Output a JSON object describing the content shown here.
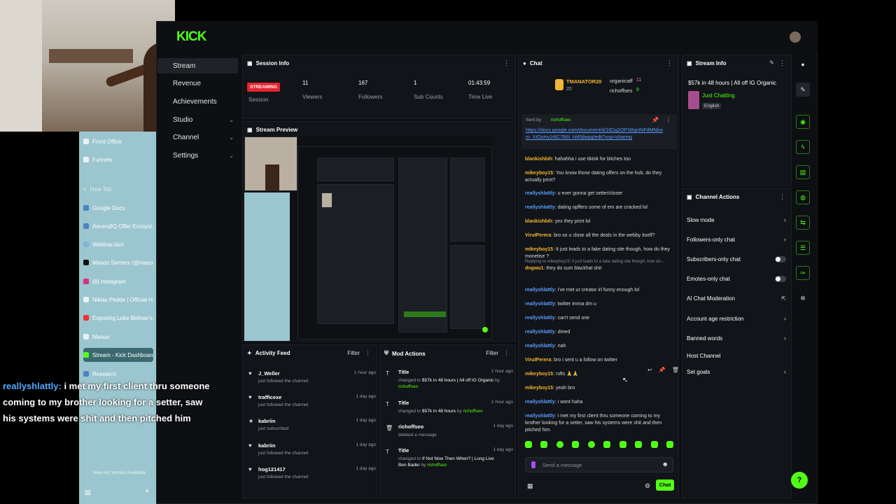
{
  "arc": {
    "items": [
      {
        "label": "Front Office"
      },
      {
        "label": "Funnels"
      },
      {
        "label": "New Tab"
      },
      {
        "label": "Google Docs"
      },
      {
        "label": "AscendIQ Offer Ecosyst..."
      },
      {
        "label": "WebinarJam"
      },
      {
        "label": "Mason Senters (@maso..."
      },
      {
        "label": "(8) Instagram"
      },
      {
        "label": "Niklas Pedde | Official H..."
      },
      {
        "label": "Exposing Luke Belmar's..."
      },
      {
        "label": "Manus"
      },
      {
        "label": "Stream - Kick Dashboard"
      },
      {
        "label": "Research"
      }
    ],
    "update_notice": "New Arc Version Available"
  },
  "caption": {
    "user": "reallyshlattly:",
    "text": " i met my first client thru someone coming to my brother looking for a setter, saw his systems were shit and then pitched him"
  },
  "logo": "KICK",
  "nav": {
    "items": [
      {
        "label": "Stream"
      },
      {
        "label": "Revenue"
      },
      {
        "label": "Achievements"
      },
      {
        "label": "Studio"
      },
      {
        "label": "Channel"
      },
      {
        "label": "Settings"
      }
    ]
  },
  "session": {
    "title": "Session Info",
    "status": "STREAMING",
    "status_label": "Session",
    "stats": [
      {
        "value": "11",
        "label": "Viewers"
      },
      {
        "value": "167",
        "label": "Followers"
      },
      {
        "value": "1",
        "label": "Sub Counts"
      },
      {
        "value": "01:43:59",
        "label": "Time Live"
      }
    ]
  },
  "preview": {
    "title": "Stream Preview"
  },
  "activity": {
    "title": "Activity Feed",
    "filter": "Filter",
    "rows": [
      {
        "name": "J_Weller",
        "sub": "just followed the channel",
        "time": "1 hour ago"
      },
      {
        "name": "trafficexe",
        "sub": "just followed the channel",
        "time": "1 day ago"
      },
      {
        "name": "kabriin",
        "sub": "just subscribed",
        "time": "1 day ago"
      },
      {
        "name": "kabriin",
        "sub": "just followed the channel",
        "time": "1 day ago"
      },
      {
        "name": "hog121417",
        "sub": "just followed the channel",
        "time": "1 day ago"
      }
    ]
  },
  "mod": {
    "title": "Mod Actions",
    "filter": "Filter",
    "rows": [
      {
        "name": "Title",
        "pre": "changed to ",
        "val": "$57k in 48 hours | All off IG Organic",
        "by": " by ",
        "who": "richoffseo",
        "time": "1 hour ago"
      },
      {
        "name": "Title",
        "pre": "changed to ",
        "val": "$57k in 48 hours",
        "by": " by ",
        "who": "richoffseo",
        "time": "1 hour ago"
      },
      {
        "name": "richoffseo",
        "pre": "deleted a message",
        "val": "",
        "by": "",
        "who": "",
        "time": "1 day ago"
      },
      {
        "name": "Title",
        "pre": "changed to ",
        "val": "If Not Now Then When? | Long Live Ben Bader",
        "by": " by ",
        "who": "richoffseo",
        "time": "1 day ago"
      }
    ]
  },
  "chat": {
    "title": "Chat",
    "top_gifters": [
      {
        "name": "TMANATOR20",
        "count": "20"
      },
      {
        "name": "organicaff",
        "count": "11"
      },
      {
        "name": "richoffseo",
        "count": "9"
      }
    ],
    "pinned": {
      "sent_by": "Sent by",
      "user": "richoffseo",
      "link": "https://docs.google.com/document/d/16Dg2OP1BqnINFdMNkwm_XIOoHy1t6C7B6l_hM5jlwpg/edit?usp=sharing"
    },
    "messages": [
      {
        "user": "blankishbih",
        "color": "gold",
        "text": "hahahha i use tiktok for bitches too"
      },
      {
        "user": "mikeyboy15",
        "color": "gold",
        "text": "You know those dating offers on the hub, do they actually print?"
      },
      {
        "user": "reallyshlattly",
        "color": "blue",
        "text": "u ever gonna get setter/closer"
      },
      {
        "user": "reallyshlattly",
        "color": "blue",
        "text": "dating opffers some of em are cracked lol"
      },
      {
        "user": "blankishbih",
        "color": "gold",
        "text": "yes they print lol"
      },
      {
        "user": "ViruIPerera",
        "color": "gold",
        "text": "bro so u close all the deals in the webby itself?"
      },
      {
        "user": "mikeyboy15",
        "color": "gold",
        "text": "It just leads to a fake dating site though, how do they monetise ?"
      },
      {
        "user": "dngwu1",
        "color": "gold",
        "text": "they do sum blackhat shit",
        "reply": "Replying to mikeyboy15: It just leads to a fake dating site though, how do..."
      },
      {
        "user": "reallyshlattly",
        "color": "blue",
        "text": "i've met ur creator irl funny enough lol"
      },
      {
        "user": "reallyshlattly",
        "color": "blue",
        "text": "twitter imma dm u"
      },
      {
        "user": "reallyshlattly",
        "color": "blue",
        "text": "can't send one"
      },
      {
        "user": "reallyshlattly",
        "color": "blue",
        "text": "dmed"
      },
      {
        "user": "reallyshlattly",
        "color": "blue",
        "text": "nah"
      },
      {
        "user": "ViruIPerera",
        "color": "gold",
        "text": "bro i sent u a follow on twitter"
      },
      {
        "user": "mikeyboy15",
        "color": "gold",
        "text": "rsfts 🙏🙏"
      },
      {
        "user": "mikeyboy15",
        "color": "gold",
        "text": "yeah bro"
      },
      {
        "user": "reallyshlattly",
        "color": "blue",
        "text": "i wont haha"
      },
      {
        "user": "reallyshlattly",
        "color": "blue",
        "text": "i met my first client thru someone coming to my brother looking for a setter, saw his systems were shit and then pitched him"
      }
    ],
    "input_placeholder": "Send a message",
    "send": "Chat"
  },
  "stream_info": {
    "title": "Stream Info",
    "stream_title": "$57k in 48 hours | All off IG Organic",
    "category": "Just Chatting",
    "language": "English"
  },
  "actions": {
    "title": "Channel Actions",
    "items": [
      {
        "label": "Slow mode",
        "kind": "arrow"
      },
      {
        "label": "Followers-only chat",
        "kind": "arrow"
      },
      {
        "label": "Subscribers-only chat",
        "kind": "toggle"
      },
      {
        "label": "Emotes-only chat",
        "kind": "toggle"
      },
      {
        "label": "AI Chat Moderation",
        "kind": "ext"
      },
      {
        "label": "Account age restriction",
        "kind": "arrow"
      },
      {
        "label": "Banned words",
        "kind": "arrow"
      },
      {
        "label": "Host Channel",
        "kind": "none"
      },
      {
        "label": "Set goals",
        "kind": "arrow"
      }
    ]
  },
  "colors": {
    "accent": "#53fc18",
    "live": "#e5242f",
    "panel": "#111418"
  }
}
